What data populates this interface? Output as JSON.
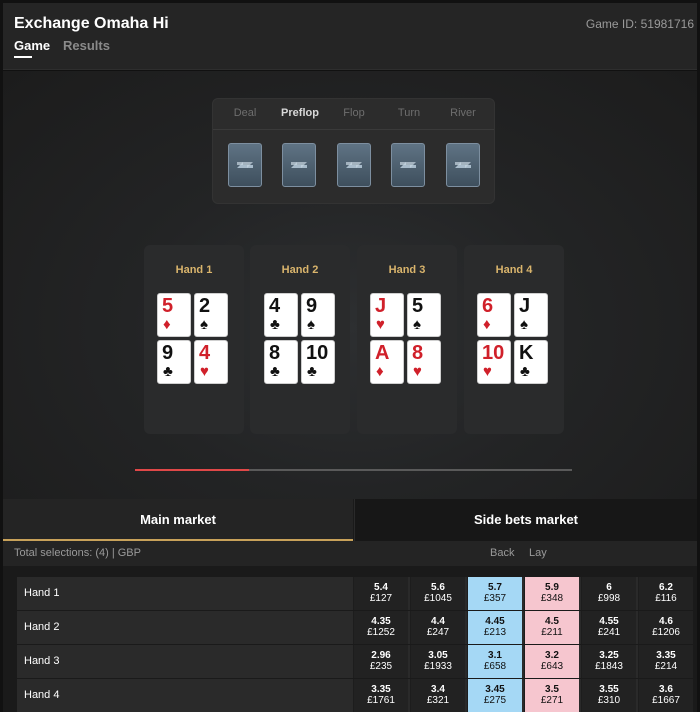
{
  "header": {
    "title": "Exchange Omaha Hi",
    "game_id": "Game ID: 51981716",
    "tabs": [
      {
        "label": "Game",
        "active": true
      },
      {
        "label": "Results",
        "active": false
      }
    ]
  },
  "stages": {
    "labels": [
      "Deal",
      "Preflop",
      "Flop",
      "Turn",
      "River"
    ],
    "active": "Preflop"
  },
  "hands": [
    {
      "name": "Hand 1",
      "cards": [
        {
          "rank": "5",
          "suit": "♦",
          "color": "red"
        },
        {
          "rank": "2",
          "suit": "♠",
          "color": "black"
        },
        {
          "rank": "9",
          "suit": "♣",
          "color": "black"
        },
        {
          "rank": "4",
          "suit": "♥",
          "color": "red"
        }
      ]
    },
    {
      "name": "Hand 2",
      "cards": [
        {
          "rank": "4",
          "suit": "♣",
          "color": "black"
        },
        {
          "rank": "9",
          "suit": "♠",
          "color": "black"
        },
        {
          "rank": "8",
          "suit": "♣",
          "color": "black"
        },
        {
          "rank": "10",
          "suit": "♣",
          "color": "black"
        }
      ]
    },
    {
      "name": "Hand 3",
      "cards": [
        {
          "rank": "J",
          "suit": "♥",
          "color": "red"
        },
        {
          "rank": "5",
          "suit": "♠",
          "color": "black"
        },
        {
          "rank": "A",
          "suit": "♦",
          "color": "red"
        },
        {
          "rank": "8",
          "suit": "♥",
          "color": "red"
        }
      ]
    },
    {
      "name": "Hand 4",
      "cards": [
        {
          "rank": "6",
          "suit": "♦",
          "color": "red"
        },
        {
          "rank": "J",
          "suit": "♠",
          "color": "black"
        },
        {
          "rank": "10",
          "suit": "♥",
          "color": "red"
        },
        {
          "rank": "K",
          "suit": "♣",
          "color": "black"
        }
      ]
    }
  ],
  "progress": {
    "fraction": 0.26,
    "color": "#e04848"
  },
  "market": {
    "tabs": [
      {
        "label": "Main market",
        "active": true
      },
      {
        "label": "Side bets market",
        "active": false
      }
    ],
    "total_selections": "Total selections: (4) | GBP",
    "back_label": "Back",
    "lay_label": "Lay",
    "colors": {
      "back": "#a5d8f5",
      "lay": "#f6c6cf"
    },
    "runners": [
      {
        "name": "Hand 1",
        "prices": [
          [
            "5.4",
            "£127"
          ],
          [
            "5.6",
            "£1045"
          ],
          [
            "5.7",
            "£357"
          ],
          [
            "5.9",
            "£348"
          ],
          [
            "6",
            "£998"
          ],
          [
            "6.2",
            "£116"
          ]
        ]
      },
      {
        "name": "Hand 2",
        "prices": [
          [
            "4.35",
            "£1252"
          ],
          [
            "4.4",
            "£247"
          ],
          [
            "4.45",
            "£213"
          ],
          [
            "4.5",
            "£211"
          ],
          [
            "4.55",
            "£241"
          ],
          [
            "4.6",
            "£1206"
          ]
        ]
      },
      {
        "name": "Hand 3",
        "prices": [
          [
            "2.96",
            "£235"
          ],
          [
            "3.05",
            "£1933"
          ],
          [
            "3.1",
            "£658"
          ],
          [
            "3.2",
            "£643"
          ],
          [
            "3.25",
            "£1843"
          ],
          [
            "3.35",
            "£214"
          ]
        ]
      },
      {
        "name": "Hand 4",
        "prices": [
          [
            "3.35",
            "£1761"
          ],
          [
            "3.4",
            "£321"
          ],
          [
            "3.45",
            "£275"
          ],
          [
            "3.5",
            "£271"
          ],
          [
            "3.55",
            "£310"
          ],
          [
            "3.6",
            "£1667"
          ]
        ]
      }
    ]
  }
}
